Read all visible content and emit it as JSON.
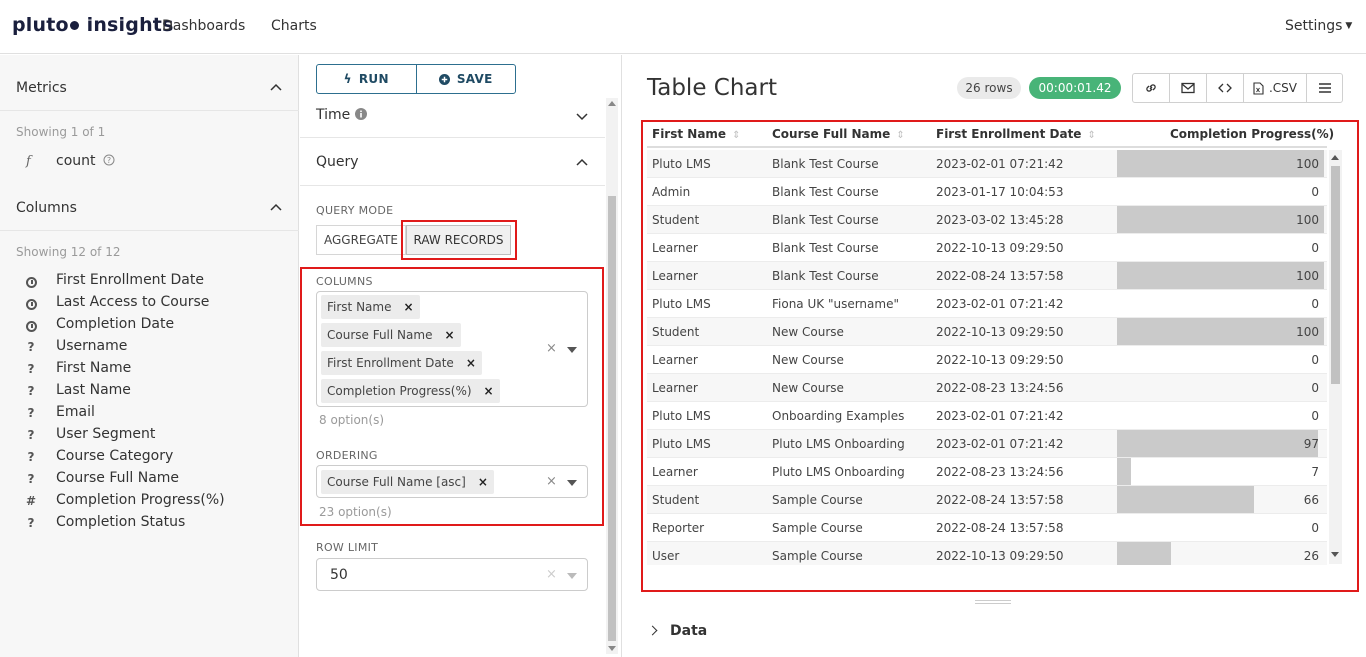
{
  "navbar": {
    "logo_a": "pluto",
    "logo_b": "insights",
    "links": [
      "Dashboards",
      "Charts"
    ],
    "settings": "Settings"
  },
  "metrics": {
    "title": "Metrics",
    "showing": "Showing 1 of 1",
    "items": [
      {
        "icon": "f",
        "label": "count"
      }
    ]
  },
  "columns": {
    "title": "Columns",
    "showing": "Showing 12 of 12",
    "items": [
      {
        "type": "time",
        "label": "First Enrollment Date"
      },
      {
        "type": "time",
        "label": "Last Access to Course"
      },
      {
        "type": "time",
        "label": "Completion Date"
      },
      {
        "type": "string",
        "label": "Username"
      },
      {
        "type": "string",
        "label": "First Name"
      },
      {
        "type": "string",
        "label": "Last Name"
      },
      {
        "type": "string",
        "label": "Email"
      },
      {
        "type": "string",
        "label": "User Segment"
      },
      {
        "type": "string",
        "label": "Course Category"
      },
      {
        "type": "string",
        "label": "Course Full Name"
      },
      {
        "type": "number",
        "label": "Completion Progress(%)"
      },
      {
        "type": "string",
        "label": "Completion Status"
      }
    ]
  },
  "controls": {
    "run_label": "RUN",
    "save_label": "SAVE",
    "time_label": "Time",
    "query_label": "Query",
    "query_mode_label": "QUERY MODE",
    "mode_aggregate": "AGGREGATE",
    "mode_raw": "RAW RECORDS",
    "columns_label": "COLUMNS",
    "column_tags": [
      "First Name",
      "Course Full Name",
      "First Enrollment Date",
      "Completion Progress(%)"
    ],
    "columns_options": "8 option(s)",
    "ordering_label": "ORDERING",
    "ordering_tags": [
      "Course Full Name [asc]"
    ],
    "ordering_options": "23 option(s)",
    "row_limit_label": "ROW LIMIT",
    "row_limit_value": "50"
  },
  "chart": {
    "title": "Table Chart",
    "rows_badge": "26 rows",
    "time_badge": "00:00:01.42",
    "csv_label": ".CSV",
    "data_label": "Data"
  },
  "table": {
    "headers": [
      "First Name",
      "Course Full Name",
      "First Enrollment Date",
      "Completion Progress(%)"
    ],
    "rows": [
      {
        "first_name": "Pluto LMS",
        "course": "Blank Test Course",
        "date": "2023-02-01 07:21:42",
        "progress": 100
      },
      {
        "first_name": "Admin",
        "course": "Blank Test Course",
        "date": "2023-01-17 10:04:53",
        "progress": 0
      },
      {
        "first_name": "Student",
        "course": "Blank Test Course",
        "date": "2023-03-02 13:45:28",
        "progress": 100
      },
      {
        "first_name": "Learner",
        "course": "Blank Test Course",
        "date": "2022-10-13 09:29:50",
        "progress": 0
      },
      {
        "first_name": "Learner",
        "course": "Blank Test Course",
        "date": "2022-08-24 13:57:58",
        "progress": 100
      },
      {
        "first_name": "Pluto LMS",
        "course": "Fiona UK \"username\"",
        "date": "2023-02-01 07:21:42",
        "progress": 0
      },
      {
        "first_name": "Student",
        "course": "New Course",
        "date": "2022-10-13 09:29:50",
        "progress": 100
      },
      {
        "first_name": "Learner",
        "course": "New Course",
        "date": "2022-10-13 09:29:50",
        "progress": 0
      },
      {
        "first_name": "Learner",
        "course": "New Course",
        "date": "2022-08-23 13:24:56",
        "progress": 0
      },
      {
        "first_name": "Pluto LMS",
        "course": "Onboarding Examples",
        "date": "2023-02-01 07:21:42",
        "progress": 0
      },
      {
        "first_name": "Pluto LMS",
        "course": "Pluto LMS Onboarding",
        "date": "2023-02-01 07:21:42",
        "progress": 97
      },
      {
        "first_name": "Learner",
        "course": "Pluto LMS Onboarding",
        "date": "2022-08-23 13:24:56",
        "progress": 7
      },
      {
        "first_name": "Student",
        "course": "Sample Course",
        "date": "2022-08-24 13:57:58",
        "progress": 66
      },
      {
        "first_name": "Reporter",
        "course": "Sample Course",
        "date": "2022-08-24 13:57:58",
        "progress": 0
      },
      {
        "first_name": "User",
        "course": "Sample Course",
        "date": "2022-10-13 09:29:50",
        "progress": 26
      }
    ]
  },
  "colors": {
    "accent": "#2d6f8f",
    "success": "#48b478",
    "highlight": "#e01a1a",
    "bar": "#cacaca"
  }
}
